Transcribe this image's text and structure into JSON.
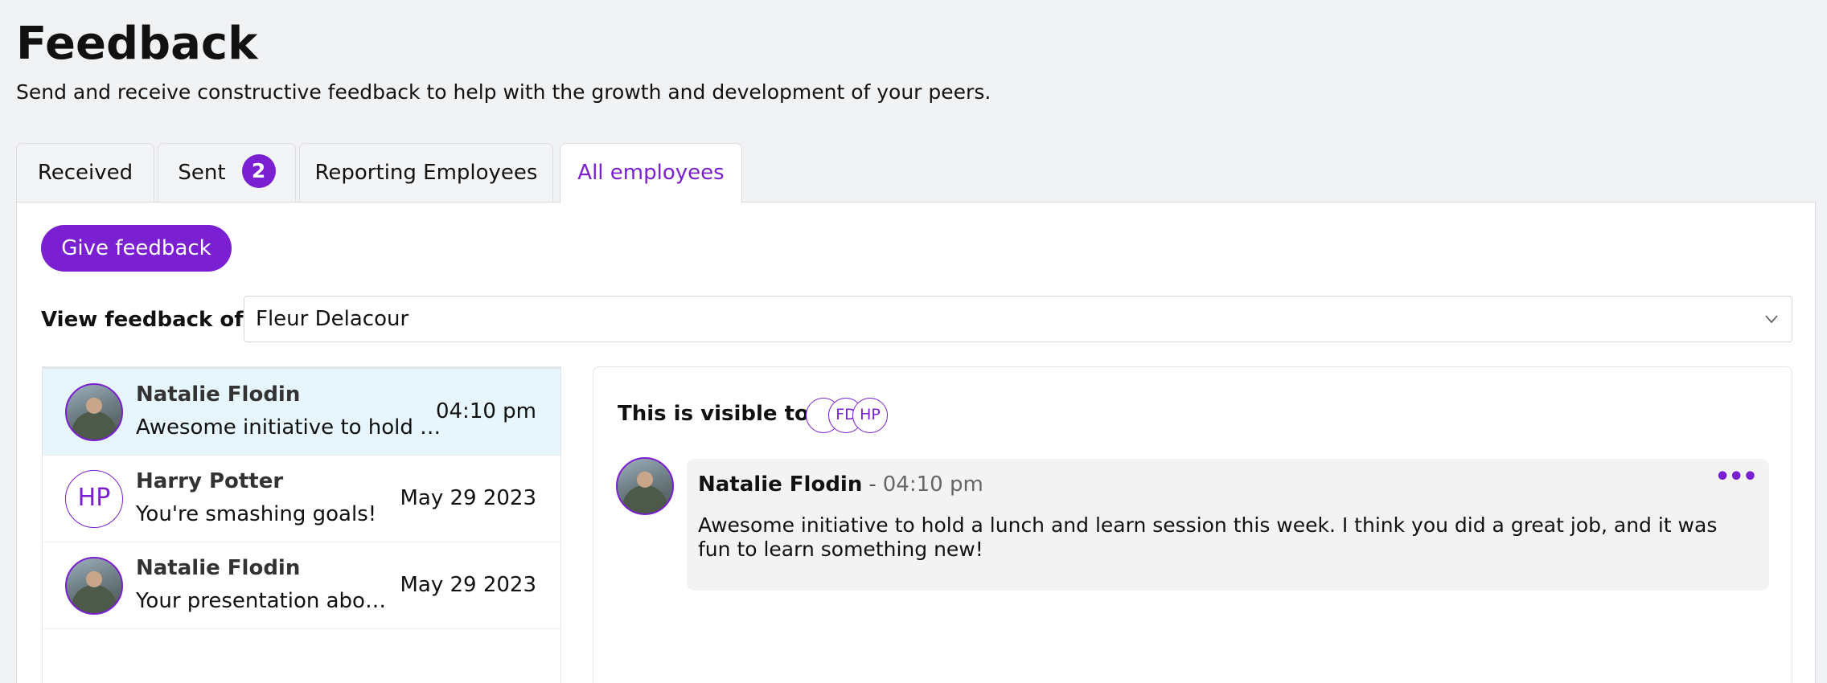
{
  "header": {
    "title": "Feedback",
    "subtitle": "Send and receive constructive feedback to help with the growth and development of your peers."
  },
  "tabs": [
    {
      "label": "Received"
    },
    {
      "label": "Sent",
      "badge": "2"
    },
    {
      "label": "Reporting Employees"
    },
    {
      "label": "All employees",
      "active": true
    }
  ],
  "toolbar": {
    "give_feedback_label": "Give feedback"
  },
  "filter": {
    "label": "View feedback of",
    "selected": "Fleur Delacour"
  },
  "feedback_list": [
    {
      "name": "Natalie Flodin",
      "preview": "Awesome initiative to hold a lunch and learn session this week.",
      "time": "04:10 pm",
      "avatar": "photo",
      "selected": true
    },
    {
      "name": "Harry Potter",
      "preview": "You're smashing goals!",
      "time": "May 29 2023",
      "avatar": "initials",
      "initials": "HP"
    },
    {
      "name": "Natalie Flodin",
      "preview": "Your presentation about the quarterly plan was great.",
      "time": "May 29 2023",
      "avatar": "photo"
    }
  ],
  "detail": {
    "visible_label": "This is visible to:",
    "visible_to": [
      {
        "type": "photo"
      },
      {
        "type": "initials",
        "initials": "FD"
      },
      {
        "type": "initials",
        "initials": "HP"
      }
    ],
    "author": "Natalie Flodin",
    "separator": "-",
    "time": "04:10 pm",
    "more_icon": "•••",
    "text": "Awesome initiative to hold a lunch and learn session this week. I think you did a great job, and it was fun to learn something new!"
  },
  "colors": {
    "accent": "#7a1fd1",
    "selected_row": "#e6f6fc",
    "background": "#f1f2f4"
  }
}
